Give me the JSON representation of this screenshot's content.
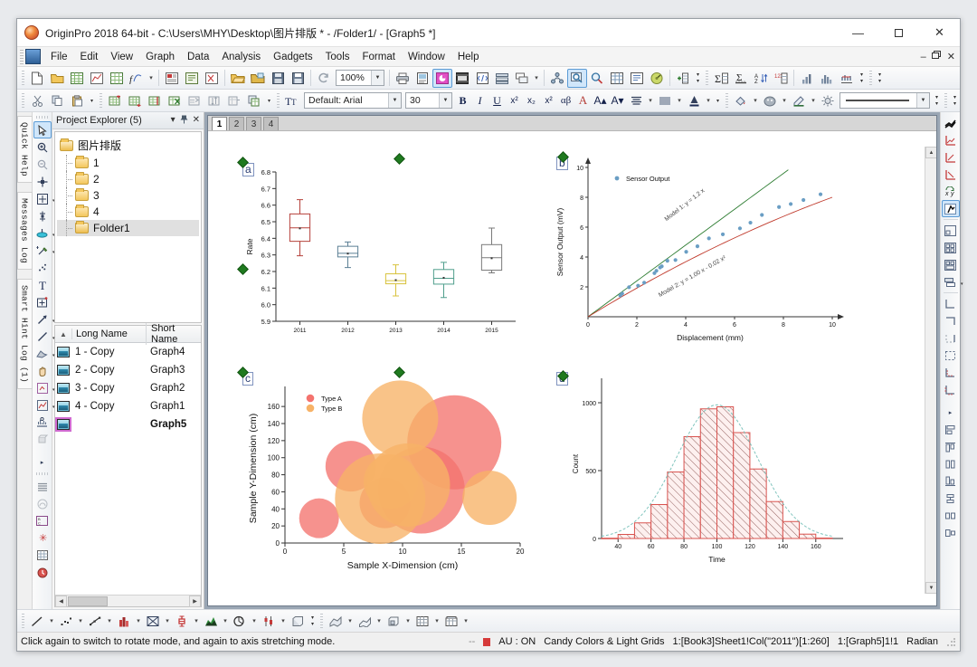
{
  "window": {
    "title": "OriginPro 2018 64-bit - C:\\Users\\MHY\\Desktop\\图片排版 * - /Folder1/ - [Graph5 *]",
    "minimize": "—",
    "maximize": "☐",
    "close": "✕",
    "mdi_minimize": "–",
    "mdi_restore": "❐",
    "mdi_close": "✕"
  },
  "menu": {
    "items": [
      {
        "label": "File"
      },
      {
        "label": "Edit"
      },
      {
        "label": "View"
      },
      {
        "label": "Graph"
      },
      {
        "label": "Data"
      },
      {
        "label": "Analysis"
      },
      {
        "label": "Gadgets"
      },
      {
        "label": "Tools"
      },
      {
        "label": "Format"
      },
      {
        "label": "Window"
      },
      {
        "label": "Help"
      }
    ]
  },
  "toolbar_standard": {
    "zoom_value": "100%",
    "icons": [
      "new-project-icon",
      "new-folder-icon",
      "new-workbook-icon",
      "new-graph-icon",
      "new-matrix-icon",
      "new-function-icon",
      "new-layout-icon",
      "new-notes-icon",
      "new-excel-icon",
      "open-icon",
      "open-template-icon",
      "save-project-icon",
      "save-template-icon",
      "refresh-icon",
      "print-icon",
      "print-preview-icon",
      "import-wizard-icon",
      "import-single-ascii-icon",
      "import-multiple-icon",
      "duplicate-icon",
      "clear-worksheet-icon",
      "project-explorer-icon",
      "results-log-icon",
      "command-window-icon",
      "code-builder-icon",
      "layer-management-icon",
      "add-new-layer-icon",
      "extract-worksheet-icon",
      "statistics-icon",
      "sort-worksheet-icon",
      "set-column-values-icon",
      "column-statistics-icon",
      "histogram-icon",
      "normality-test-icon"
    ]
  },
  "toolbar_edit": {
    "icons": [
      "cut-icon",
      "copy-icon",
      "paste-icon",
      "add-new-column-icon",
      "add-new-row-icon",
      "insert-column-icon",
      "delete-column-icon",
      "transpose-icon",
      "sort-range-icon",
      "move-column-icon",
      "copy-columns-icon"
    ]
  },
  "toolbar_format": {
    "font_name": "Default: Arial",
    "font_size": "30",
    "bold": "B",
    "italic": "I",
    "underline": "U",
    "superscript": "x²",
    "subscript": "x₂",
    "supsub": "x²",
    "greek": "αβ",
    "increase_font": "A▴",
    "decrease_font": "A▾",
    "icons": [
      "text-tool-icon",
      "align-icon",
      "line-spacing-icon",
      "font-color-icon",
      "fill-color-icon",
      "pattern-color-icon",
      "line-color-icon",
      "line-thickness-icon",
      "line-style-icon"
    ]
  },
  "left_dock": {
    "tabs": [
      {
        "label": "Quick Help"
      },
      {
        "label": "Messages Log"
      },
      {
        "label": "Smart Hint Log (1)"
      }
    ],
    "tools": [
      "pointer-icon",
      "zoom-in-icon",
      "zoom-out-icon",
      "data-reader-icon",
      "screen-reader-icon",
      "data-selector-icon",
      "data-cursor-icon",
      "draw-data-icon",
      "regional-mask-icon",
      "text-tool-icon",
      "annotation-icon",
      "arrow-tool-icon",
      "line-tool-icon",
      "polygon-tool-icon",
      "pan-tool-icon",
      "region-zoom-icon",
      "scale-in-icon",
      "enlarger-icon",
      "rotate-icon"
    ]
  },
  "right_dock": {
    "tools_top": [
      "stack-lines-icon",
      "rescale-axes-icon",
      "axis-scale-in-icon",
      "axis-scale-out-icon",
      "exchange-xy-icon",
      "speed-mode-icon",
      "merge-graph-icon",
      "extract-to-layers-icon",
      "extract-to-graphs-icon",
      "layer-contents-icon",
      "frame-bottom-left-icon",
      "frame-top-icon",
      "frame-right-icon",
      "frame-all-icon",
      "axis-tick-in-icon",
      "axis-tick-out-icon"
    ],
    "tools_bottom": [
      "align-left-icon",
      "align-top-icon",
      "align-center-icon",
      "align-bottom-icon",
      "distribute-horizontal-icon",
      "distribute-vertical-icon",
      "size-match-icon"
    ]
  },
  "project_explorer": {
    "title": "Project Explorer (5)",
    "menu_icon": "▾",
    "pin_icon": "π",
    "close_icon": "✕",
    "tree": {
      "root": "图片排版",
      "children": [
        "1",
        "2",
        "3",
        "4",
        "Folder1"
      ],
      "selected": "Folder1"
    },
    "list": {
      "columns": [
        "Long Name",
        "Short Name"
      ],
      "sort_glyph": "▲",
      "rows": [
        {
          "long_name": "1 - Copy",
          "short_name": "Graph4",
          "active": false
        },
        {
          "long_name": "2 - Copy",
          "short_name": "Graph3",
          "active": false
        },
        {
          "long_name": "3 - Copy",
          "short_name": "Graph2",
          "active": false
        },
        {
          "long_name": "4 - Copy",
          "short_name": "Graph1",
          "active": false
        },
        {
          "long_name": "",
          "short_name": "Graph5",
          "active": true
        }
      ]
    }
  },
  "graph_window": {
    "tabs": [
      {
        "label": "1",
        "active": true
      },
      {
        "label": "2",
        "active": false
      },
      {
        "label": "3",
        "active": false
      },
      {
        "label": "4",
        "active": false
      }
    ]
  },
  "bottom_toolbar": {
    "icons": [
      "line-plot-icon",
      "scatter-plot-icon",
      "line-symbol-icon",
      "column-plot-icon",
      "area-plot-icon",
      "box-chart-icon",
      "fill-area-icon",
      "pie-chart-icon",
      "floating-bar-icon",
      "3d-wall-icon",
      "3d-surface-icon",
      "3d-scatter-icon",
      "3d-bar-icon",
      "contour-icon",
      "image-plot-icon"
    ]
  },
  "statusbar": {
    "message": "Click again to switch to rotate mode, and again to axis stretching mode.",
    "dash": "--",
    "flag": "red-flag-icon",
    "auto_update": "AU : ON",
    "theme": "Candy Colors & Light Grids",
    "selection": "1:[Book3]Sheet1!Col(\"2011\")[1:260]",
    "window_info": "1:[Graph5]1!1",
    "angle_unit": "Radian"
  },
  "colors": {
    "accent": "#5b9bd5",
    "box_red": "#b5403a",
    "box_blue": "#5b7f94",
    "box_yellow": "#d8c23c",
    "box_teal": "#4f9e8c",
    "box_gray": "#7a7a7a",
    "scatter_blue": "#6a9ec4",
    "model1_line": "#2e7d32",
    "model2_line": "#c0392b",
    "bubble_a": "#f4736e",
    "bubble_b": "#f7b267",
    "hist_line": "#d9534f",
    "hist_curve": "#7fc4bd",
    "handle_green": "#1f7a1f"
  },
  "chart_data": [
    {
      "id": "panel-a",
      "label": "a",
      "type": "box",
      "title": "",
      "xlabel": "",
      "ylabel": "Rate",
      "ylim": [
        5.9,
        6.8
      ],
      "yticks": [
        5.9,
        6.0,
        6.1,
        6.2,
        6.3,
        6.4,
        6.5,
        6.6,
        6.7,
        6.8
      ],
      "categories": [
        "2011",
        "2012",
        "2013",
        "2014",
        "2015"
      ],
      "boxes": [
        {
          "category": "2011",
          "whisker_low": 6.295,
          "q1": 6.382,
          "median": 6.463,
          "q3": 6.547,
          "whisker_high": 6.633,
          "mean": 6.46,
          "color": "#b5403a"
        },
        {
          "category": "2012",
          "whisker_low": 6.224,
          "q1": 6.288,
          "median": 6.31,
          "q3": 6.352,
          "whisker_high": 6.378,
          "mean": 6.308,
          "color": "#5b7f94"
        },
        {
          "category": "2013",
          "whisker_low": 6.053,
          "q1": 6.126,
          "median": 6.145,
          "q3": 6.186,
          "whisker_high": 6.24,
          "mean": 6.148,
          "color": "#d8c23c"
        },
        {
          "category": "2014",
          "whisker_low": 6.043,
          "q1": 6.124,
          "median": 6.159,
          "q3": 6.212,
          "whisker_high": 6.255,
          "mean": 6.162,
          "color": "#4f9e8c"
        },
        {
          "category": "2015",
          "whisker_low": 6.192,
          "q1": 6.208,
          "median": 6.283,
          "q3": 6.362,
          "whisker_high": 6.462,
          "mean": 6.28,
          "color": "#7a7a7a"
        }
      ],
      "grid": false
    },
    {
      "id": "panel-b",
      "label": "b",
      "type": "scatter",
      "xlabel": "Displacement (mm)",
      "ylabel": "Sensor Output (mV)",
      "xlim": [
        0,
        10
      ],
      "ylim": [
        0,
        10
      ],
      "xticks": [
        0,
        2,
        4,
        6,
        8,
        10
      ],
      "yticks": [
        0,
        2,
        4,
        6,
        8,
        10
      ],
      "legend": [
        {
          "name": "Sensor Output",
          "color": "#6a9ec4"
        }
      ],
      "points": [
        {
          "x": 1.32,
          "y": 1.42
        },
        {
          "x": 1.4,
          "y": 1.55
        },
        {
          "x": 1.68,
          "y": 1.98
        },
        {
          "x": 2.05,
          "y": 2.08
        },
        {
          "x": 2.3,
          "y": 2.28
        },
        {
          "x": 2.72,
          "y": 2.92
        },
        {
          "x": 2.8,
          "y": 3.08
        },
        {
          "x": 2.95,
          "y": 3.3
        },
        {
          "x": 3.02,
          "y": 3.38
        },
        {
          "x": 3.25,
          "y": 3.75
        },
        {
          "x": 3.58,
          "y": 3.8
        },
        {
          "x": 4.02,
          "y": 4.35
        },
        {
          "x": 4.48,
          "y": 4.72
        },
        {
          "x": 4.95,
          "y": 5.25
        },
        {
          "x": 5.52,
          "y": 5.52
        },
        {
          "x": 6.22,
          "y": 5.92
        },
        {
          "x": 6.65,
          "y": 6.3
        },
        {
          "x": 7.12,
          "y": 6.82
        },
        {
          "x": 7.82,
          "y": 7.35
        },
        {
          "x": 8.3,
          "y": 7.55
        },
        {
          "x": 8.82,
          "y": 7.82
        },
        {
          "x": 9.52,
          "y": 8.2
        }
      ],
      "annotations": [
        {
          "text": "Model 1: y = 1.2 x",
          "color": "#2e7d32"
        },
        {
          "text": "Model 2: y = 1.00 x - 0.02 x²",
          "color": "#c0392b"
        }
      ],
      "fits": [
        {
          "name": "Model 1",
          "kind": "linear",
          "a": 1.2,
          "b": 0,
          "color": "#2e7d32"
        },
        {
          "name": "Model 2",
          "kind": "quadratic",
          "a": 1.0,
          "b": -0.02,
          "color": "#c0392b"
        }
      ]
    },
    {
      "id": "panel-c",
      "label": "c",
      "type": "bubble",
      "xlabel": "Sample X-Dimension (cm)",
      "ylabel": "Sample Y-Dimension (cm)",
      "xlim": [
        0,
        20
      ],
      "ylim": [
        0,
        175
      ],
      "xticks": [
        0,
        5,
        10,
        15,
        20
      ],
      "yticks": [
        0,
        20,
        40,
        60,
        80,
        100,
        120,
        140,
        160
      ],
      "legend": [
        {
          "name": "Type A",
          "color": "#f4736e"
        },
        {
          "name": "Type B",
          "color": "#f7b267"
        }
      ],
      "bubbles": [
        {
          "x": 2.9,
          "y": 29,
          "size": 22,
          "series": "Type A"
        },
        {
          "x": 5.6,
          "y": 90,
          "size": 28,
          "series": "Type A"
        },
        {
          "x": 14.4,
          "y": 118,
          "size": 52,
          "series": "Type A"
        },
        {
          "x": 11.6,
          "y": 62,
          "size": 48,
          "series": "Type A"
        },
        {
          "x": 8.5,
          "y": 47,
          "size": 28,
          "series": "Type A"
        },
        {
          "x": 9.8,
          "y": 146,
          "size": 42,
          "series": "Type B"
        },
        {
          "x": 9.0,
          "y": 72,
          "size": 30,
          "series": "Type B"
        },
        {
          "x": 8.1,
          "y": 52,
          "size": 50,
          "series": "Type B"
        },
        {
          "x": 10.5,
          "y": 68,
          "size": 46,
          "series": "Type B"
        },
        {
          "x": 17.4,
          "y": 53,
          "size": 30,
          "series": "Type B"
        }
      ]
    },
    {
      "id": "panel-d",
      "label": "d",
      "type": "bar",
      "xlabel": "Time",
      "ylabel": "Count",
      "xlim": [
        30,
        170
      ],
      "ylim": [
        0,
        1100
      ],
      "xticks": [
        40,
        60,
        80,
        100,
        120,
        140,
        160
      ],
      "yticks": [
        0,
        500,
        1000
      ],
      "categories": [
        "35",
        "45",
        "55",
        "65",
        "75",
        "85",
        "95",
        "105",
        "115",
        "125",
        "135",
        "145",
        "155",
        "165"
      ],
      "bin_starts": [
        30,
        40,
        50,
        60,
        70,
        80,
        90,
        100,
        110,
        120,
        130,
        140,
        150,
        160
      ],
      "bin_width": 10,
      "values": [
        2,
        30,
        115,
        250,
        490,
        750,
        955,
        970,
        780,
        512,
        272,
        125,
        32,
        3
      ],
      "curve": "normal-fit",
      "grid": false
    }
  ]
}
